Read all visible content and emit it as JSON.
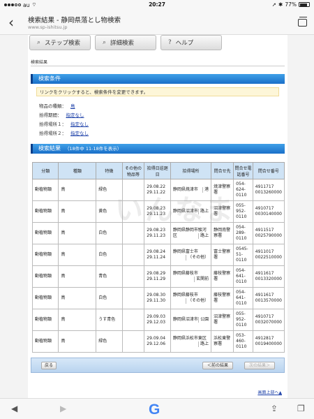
{
  "status": {
    "carrier": "au",
    "time": "20:27",
    "battery": "77%"
  },
  "browser": {
    "back_icon": "chevron-left-icon",
    "title": "検索結果 - 静岡県落とし物検索",
    "url": "www.sp-ishitsu.jp",
    "tabs_icon": "tabs-icon"
  },
  "nav": [
    {
      "label": "ステップ検索",
      "icon": "search-icon"
    },
    {
      "label": "詳細検索",
      "icon": "search-plus-icon"
    },
    {
      "label": "ヘルプ",
      "icon": "help-icon"
    }
  ],
  "breadcrumb": "検索結果",
  "conditions": {
    "heading": "検索条件",
    "notice": "リンクをクリックすると、検索条件を変更できます。",
    "rows": [
      {
        "label": "物品の種類：",
        "value": "鳥"
      },
      {
        "label": "拾得期間：",
        "value": "指定なし"
      },
      {
        "label": "拾得場所１：",
        "value": "指定なし"
      },
      {
        "label": "拾得場所２：",
        "value": "指定なし"
      }
    ]
  },
  "results": {
    "heading": "検索結果",
    "summary": "（18件中 11-18件を表示）",
    "columns": [
      "分類",
      "種類",
      "特徴",
      "その他の物品等",
      "拾得日巡廻日",
      "拾得場所",
      "問合せ先",
      "問合せ電話番号",
      "問合せ番号"
    ],
    "rows": [
      [
        "動植物類",
        "鳥",
        "緑色",
        "",
        "29.08.22\n29.11.22",
        "静岡県焼津市",
        "港",
        "焼津警察署",
        "054-624-0110",
        "4911717\n0013260000"
      ],
      [
        "動植物類",
        "鳥",
        "黄色",
        "",
        "29.08.23\n29.11.23",
        "静岡県沼津市",
        "路上",
        "沼津警察署",
        "055-952-0110",
        "4910717\n0030140000"
      ],
      [
        "動植物類",
        "鳥",
        "白色",
        "",
        "29.08.23\n29.11.23",
        "静岡県静岡市駿河区",
        "路上",
        "静岡南警察署",
        "054-289-0110",
        "4911517\n0025790000"
      ],
      [
        "動植物類",
        "鳥",
        "白色",
        "",
        "29.08.24\n29.11.24",
        "静岡県富士市",
        "（その他）",
        "富士警察署",
        "0545-51-0110",
        "4911017\n0022510000"
      ],
      [
        "動植物類",
        "鳥",
        "青色",
        "",
        "29.08.29\n29.11.29",
        "静岡県藤枝市",
        "玄関前",
        "藤枝警察署",
        "054-641-0110",
        "4911617\n0013320000"
      ],
      [
        "動植物類",
        "鳥",
        "白色",
        "",
        "29.08.30\n29.11.30",
        "静岡県藤枝市",
        "（その他）",
        "藤枝警察署",
        "054-641-0110",
        "4911617\n0013570000"
      ],
      [
        "動植物類",
        "鳥",
        "うす青色",
        "",
        "29.09.03\n29.12.03",
        "静岡県沼津市",
        "公園",
        "沼津警察署",
        "055-952-0110",
        "4910717\n0032070000"
      ],
      [
        "動植物類",
        "鳥",
        "緑色",
        "",
        "29.09.04\n29.12.06",
        "静岡県浜松市東区",
        "路上",
        "浜松東警察署",
        "053-460-0110",
        "4912817\n0019400000"
      ]
    ]
  },
  "watermark": "いんなま",
  "pager": {
    "back": "戻る",
    "prev": "＜前の結果",
    "next": "次の結果＞"
  },
  "top_link": "画面上部へ▲",
  "bottom": {
    "back": "◀",
    "forward": "▶",
    "logo": "G",
    "share": "share-icon",
    "tabs": "tabs-icon"
  }
}
